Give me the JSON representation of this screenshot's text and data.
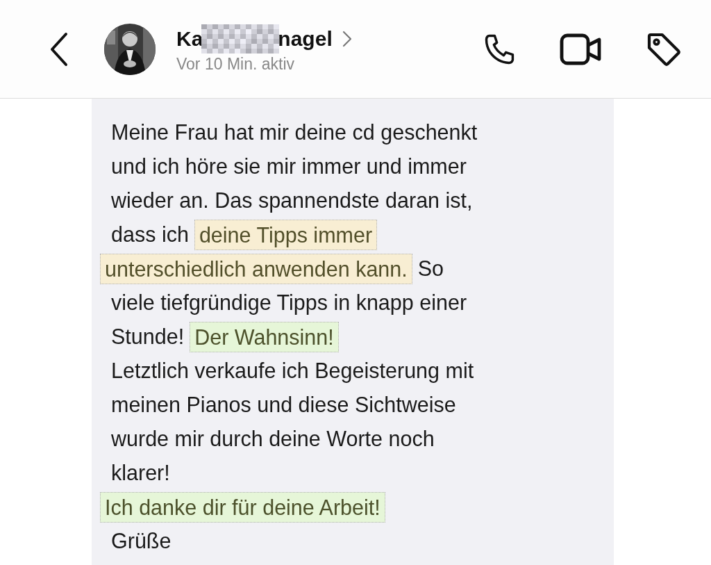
{
  "header": {
    "contact": {
      "name_start": "Ka",
      "name_end": "nagel",
      "status": "Vor 10 Min. aktiv"
    }
  },
  "message": {
    "lines": [
      [
        {
          "kind": "plain",
          "text": "Meine Frau hat mir deine cd geschenkt"
        }
      ],
      [
        {
          "kind": "plain",
          "text": "und ich höre sie mir immer und immer"
        }
      ],
      [
        {
          "kind": "plain",
          "text": "wieder an. Das spannendste daran ist,"
        }
      ],
      [
        {
          "kind": "plain",
          "text": "dass ich"
        },
        {
          "kind": "highlight",
          "color": "#f8eed3",
          "text": "deine Tipps immer"
        }
      ],
      [
        {
          "kind": "highlight",
          "color": "#f8eed3",
          "text": "unterschiedlich anwenden kann."
        },
        {
          "kind": "plain",
          "text": "So"
        }
      ],
      [
        {
          "kind": "plain",
          "text": "viele tiefgründige Tipps in knapp einer"
        }
      ],
      [
        {
          "kind": "plain",
          "text": "Stunde!"
        },
        {
          "kind": "highlight",
          "color": "#e6f6d8",
          "text": "Der Wahnsinn!"
        }
      ],
      [
        {
          "kind": "plain",
          "text": "Letztlich verkaufe ich Begeisterung mit"
        }
      ],
      [
        {
          "kind": "plain",
          "text": "meinen Pianos und diese Sichtweise"
        }
      ],
      [
        {
          "kind": "plain",
          "text": "wurde mir durch deine Worte noch"
        }
      ],
      [
        {
          "kind": "plain",
          "text": "klarer!"
        }
      ],
      [
        {
          "kind": "highlight",
          "color": "#e6f6d8",
          "text": "Ich danke dir für deine Arbeit!"
        }
      ],
      [
        {
          "kind": "plain",
          "text": "Grüße"
        }
      ]
    ]
  }
}
